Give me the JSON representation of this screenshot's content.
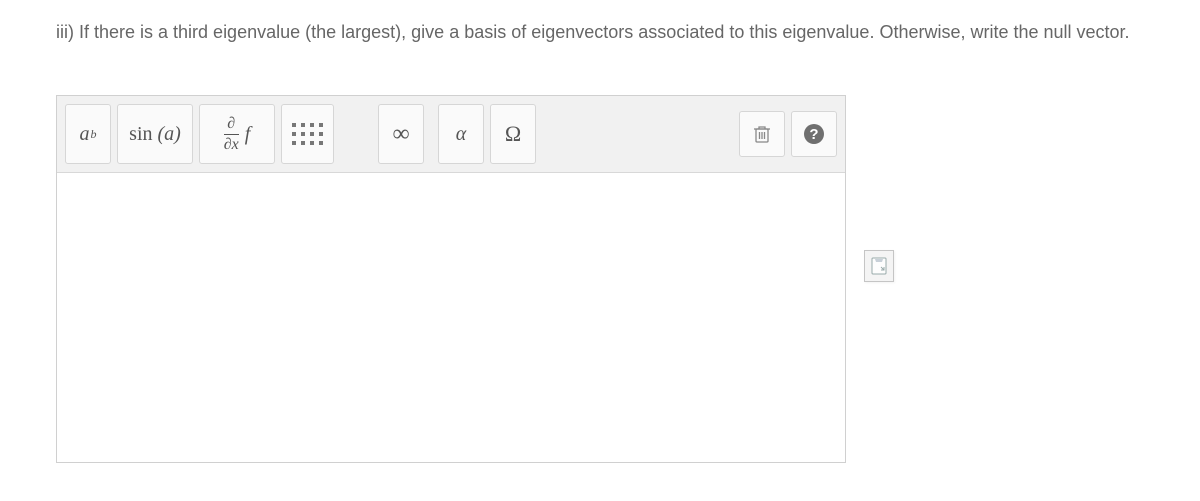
{
  "question": "iii) If there is a third eigenvalue (the largest), give a basis of eigenvectors associated to this eigenvalue. Otherwise, write the null vector.",
  "toolbar": {
    "power_base": "a",
    "power_exp": "b",
    "sin_label": "sin",
    "sin_arg": "a",
    "partial_num": "∂",
    "partial_den": "∂x",
    "partial_f": "f",
    "infinity": "∞",
    "alpha": "α",
    "omega": "Ω"
  },
  "icons": {
    "matrix": "matrix-icon",
    "trash": "trash-icon",
    "help": "help-icon",
    "fullscreen": "fullscreen-icon"
  }
}
